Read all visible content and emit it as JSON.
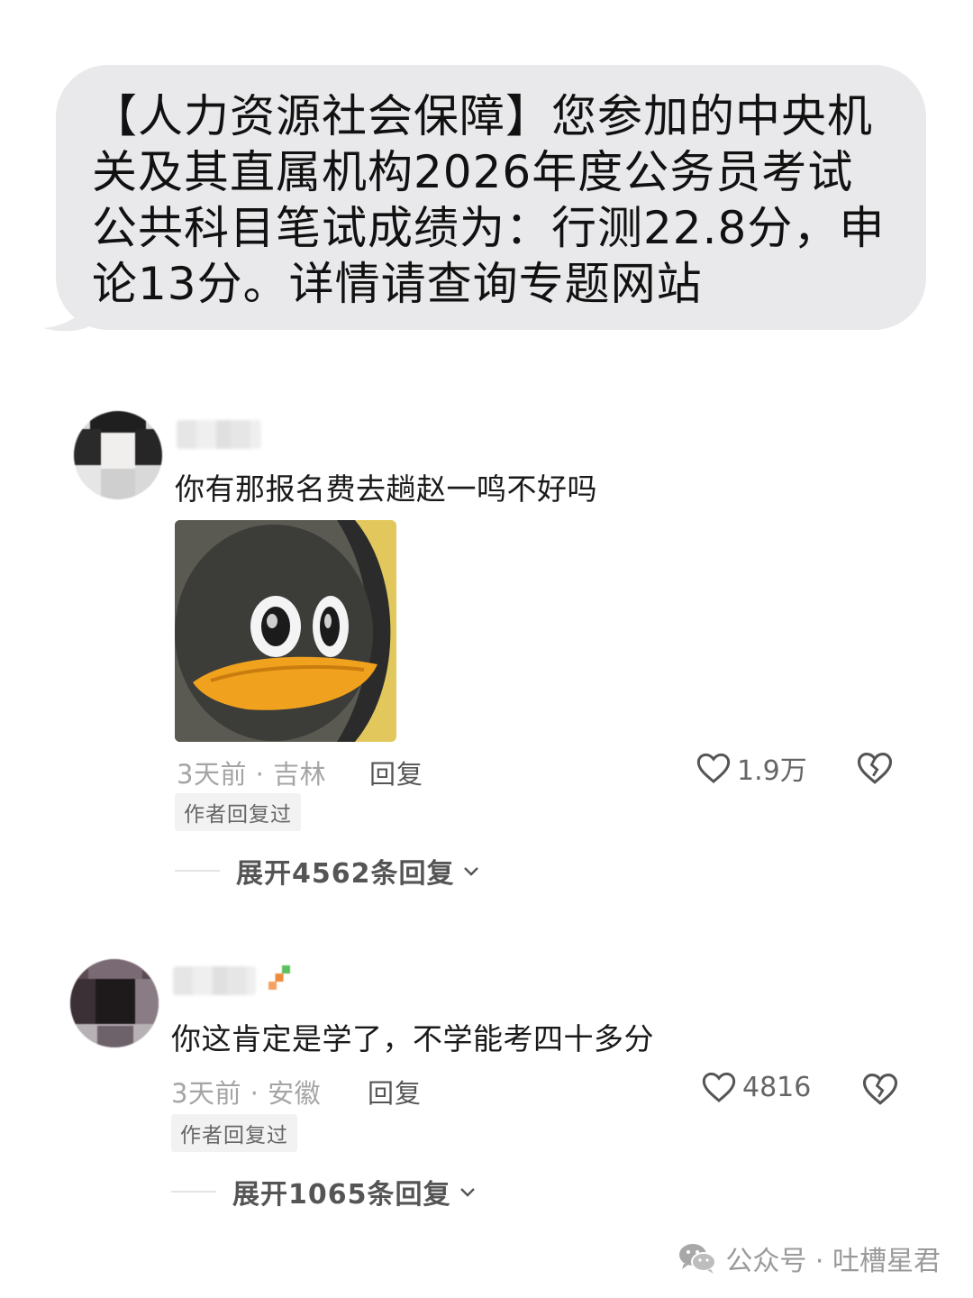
{
  "sms": {
    "text": "【人力资源社会保障】您参加的中央机关及其直属机构2026年度公务员考试公共科目笔试成绩为：行测22.8分，申论13分。详情请查询专题网站"
  },
  "comments": [
    {
      "text": "你有那报名费去趟赵一鸣不好吗",
      "time_location": "3天前 · 吉林",
      "reply_label": "回复",
      "likes": "1.9万",
      "badge": "作者回复过",
      "expand": "展开4562条回复",
      "has_sticker": true
    },
    {
      "text": "你这肯定是学了，不学能考四十多分",
      "time_location": "3天前 · 安徽",
      "reply_label": "回复",
      "likes": "4816",
      "badge": "作者回复过",
      "expand": "展开1065条回复",
      "has_sticker": false
    }
  ],
  "watermark": {
    "text": "公众号 · 吐槽星君",
    "icon": "wechat-icon"
  },
  "colors": {
    "bubble": "#e9e9eb",
    "meta_text": "#a5a5a5",
    "sticker_beak": "#f0a21e"
  }
}
